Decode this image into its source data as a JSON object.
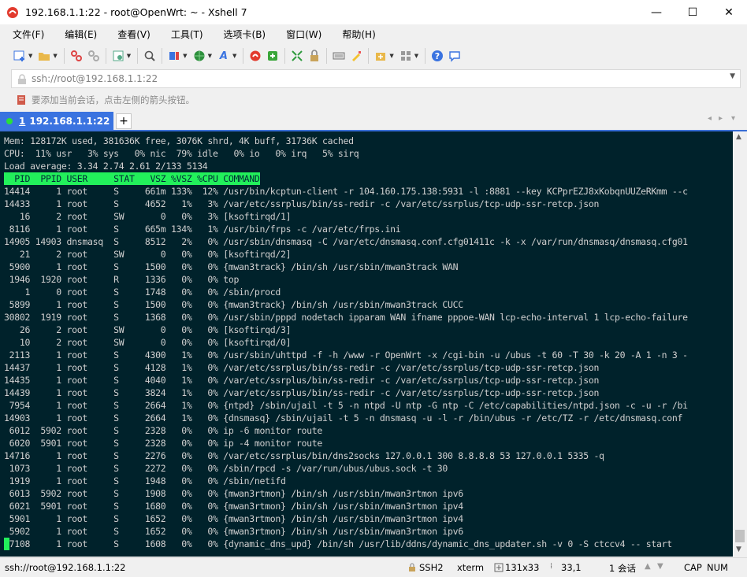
{
  "window": {
    "title": "192.168.1.1:22 - root@OpenWrt: ~ - Xshell 7",
    "minimize": "—",
    "maximize": "☐",
    "close": "✕"
  },
  "menu": [
    "文件(F)",
    "编辑(E)",
    "查看(V)",
    "工具(T)",
    "选项卡(B)",
    "窗口(W)",
    "帮助(H)"
  ],
  "address": {
    "value": "ssh://root@192.168.1.1:22"
  },
  "hint": {
    "text": "要添加当前会话，点击左侧的箭头按钮。"
  },
  "tab": {
    "number": "1",
    "label": "192.168.1.1:22"
  },
  "terminal": {
    "summary": [
      "Mem: 128172K used, 381636K free, 3076K shrd, 4K buff, 31736K cached",
      "CPU:  11% usr   3% sys   0% nic  79% idle   0% io   0% irq   5% sirq",
      "Load average: 3.34 2.74 2.61 2/133 5134"
    ],
    "header": "  PID  PPID USER     STAT   VSZ %VSZ %CPU COMMAND",
    "rows": [
      "14414     1 root     S     661m 133%  12% /usr/bin/kcptun-client -r 104.160.175.138:5931 -l :8881 --key KCPprEZJ8xKobqnUUZeRKmm --c",
      "14433     1 root     S     4652   1%   3% /var/etc/ssrplus/bin/ss-redir -c /var/etc/ssrplus/tcp-udp-ssr-retcp.json",
      "   16     2 root     SW       0   0%   3% [ksoftirqd/1]",
      " 8116     1 root     S     665m 134%   1% /usr/bin/frps -c /var/etc/frps.ini",
      "14905 14903 dnsmasq  S     8512   2%   0% /usr/sbin/dnsmasq -C /var/etc/dnsmasq.conf.cfg01411c -k -x /var/run/dnsmasq/dnsmasq.cfg01",
      "   21     2 root     SW       0   0%   0% [ksoftirqd/2]",
      " 5900     1 root     S     1500   0%   0% {mwan3track} /bin/sh /usr/sbin/mwan3track WAN",
      " 1946  1920 root     R     1336   0%   0% top",
      "    1     0 root     S     1748   0%   0% /sbin/procd",
      " 5899     1 root     S     1500   0%   0% {mwan3track} /bin/sh /usr/sbin/mwan3track CUCC",
      "30802  1919 root     S     1368   0%   0% /usr/sbin/pppd nodetach ipparam WAN ifname pppoe-WAN lcp-echo-interval 1 lcp-echo-failure",
      "   26     2 root     SW       0   0%   0% [ksoftirqd/3]",
      "   10     2 root     SW       0   0%   0% [ksoftirqd/0]",
      " 2113     1 root     S     4300   1%   0% /usr/sbin/uhttpd -f -h /www -r OpenWrt -x /cgi-bin -u /ubus -t 60 -T 30 -k 20 -A 1 -n 3 -",
      "14437     1 root     S     4128   1%   0% /var/etc/ssrplus/bin/ss-redir -c /var/etc/ssrplus/tcp-udp-ssr-retcp.json",
      "14435     1 root     S     4040   1%   0% /var/etc/ssrplus/bin/ss-redir -c /var/etc/ssrplus/tcp-udp-ssr-retcp.json",
      "14439     1 root     S     3824   1%   0% /var/etc/ssrplus/bin/ss-redir -c /var/etc/ssrplus/tcp-udp-ssr-retcp.json",
      " 7954     1 root     S     2664   1%   0% {ntpd} /sbin/ujail -t 5 -n ntpd -U ntp -G ntp -C /etc/capabilities/ntpd.json -c -u -r /bi",
      "14903     1 root     S     2664   1%   0% {dnsmasq} /sbin/ujail -t 5 -n dnsmasq -u -l -r /bin/ubus -r /etc/TZ -r /etc/dnsmasq.conf",
      " 6012  5902 root     S     2328   0%   0% ip -6 monitor route",
      " 6020  5901 root     S     2328   0%   0% ip -4 monitor route",
      "14716     1 root     S     2276   0%   0% /var/etc/ssrplus/bin/dns2socks 127.0.0.1 300 8.8.8.8 53 127.0.0.1 5335 -q",
      " 1073     1 root     S     2272   0%   0% /sbin/rpcd -s /var/run/ubus/ubus.sock -t 30",
      " 1919     1 root     S     1948   0%   0% /sbin/netifd",
      " 6013  5902 root     S     1908   0%   0% {mwan3rtmon} /bin/sh /usr/sbin/mwan3rtmon ipv6",
      " 6021  5901 root     S     1680   0%   0% {mwan3rtmon} /bin/sh /usr/sbin/mwan3rtmon ipv4",
      " 5901     1 root     S     1652   0%   0% {mwan3rtmon} /bin/sh /usr/sbin/mwan3rtmon ipv4",
      " 5902     1 root     S     1652   0%   0% {mwan3rtmon} /bin/sh /usr/sbin/mwan3rtmon ipv6",
      " 7108     1 root     S     1608   0%   0% {dynamic_dns_upd} /bin/sh /usr/lib/ddns/dynamic_dns_updater.sh -v 0 -S ctccv4 -- start"
    ]
  },
  "status": {
    "connection": "ssh://root@192.168.1.1:22",
    "protocol": "SSH2",
    "terminal_type": "xterm",
    "size": "131x33",
    "cursor_pos": "33,1",
    "sessions": "1 会话",
    "caps": "CAP",
    "num": "NUM"
  },
  "icons": {
    "app": "xshell-logo-icon",
    "lock": "lock-icon",
    "colors": {
      "accent": "#3a73e0",
      "terminal_bg": "#00222b",
      "terminal_header": "#22f05b"
    }
  }
}
